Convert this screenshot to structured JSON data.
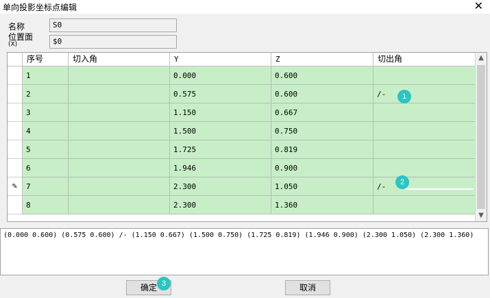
{
  "window": {
    "title": "单向投影坐标点编辑",
    "close_glyph": "✕"
  },
  "form": {
    "name_label": "名称",
    "name_value": "S0",
    "position_label": "位置面",
    "position_sublabel": "(X)",
    "position_value": "$0"
  },
  "grid": {
    "columns": [
      "序号",
      "切入角",
      "Y",
      "Z",
      "切出角"
    ],
    "rows": [
      {
        "index": "1",
        "in_angle": "",
        "y": "0.000",
        "z": "0.600",
        "out_angle": ""
      },
      {
        "index": "2",
        "in_angle": "",
        "y": "0.575",
        "z": "0.600",
        "out_angle": "/-"
      },
      {
        "index": "3",
        "in_angle": "",
        "y": "1.150",
        "z": "0.667",
        "out_angle": ""
      },
      {
        "index": "4",
        "in_angle": "",
        "y": "1.500",
        "z": "0.750",
        "out_angle": ""
      },
      {
        "index": "5",
        "in_angle": "",
        "y": "1.725",
        "z": "0.819",
        "out_angle": ""
      },
      {
        "index": "6",
        "in_angle": "",
        "y": "1.946",
        "z": "0.900",
        "out_angle": ""
      },
      {
        "index": "7",
        "in_angle": "",
        "y": "2.300",
        "z": "1.050",
        "out_angle": "/-"
      },
      {
        "index": "8",
        "in_angle": "",
        "y": "2.300",
        "z": "1.360",
        "out_angle": ""
      }
    ],
    "editing_row_marker": "✎"
  },
  "output_text": "(0.000 0.600) (0.575 0.600) /- (1.150 0.667) (1.500 0.750) (1.725 0.819) (1.946 0.900) (2.300 1.050) (2.300 1.360)",
  "buttons": {
    "ok": "确定",
    "cancel": "取消"
  },
  "badges": [
    "1",
    "2",
    "3"
  ],
  "colors": {
    "row_bg": "#c8eec8",
    "badge": "#2bc5c2"
  }
}
